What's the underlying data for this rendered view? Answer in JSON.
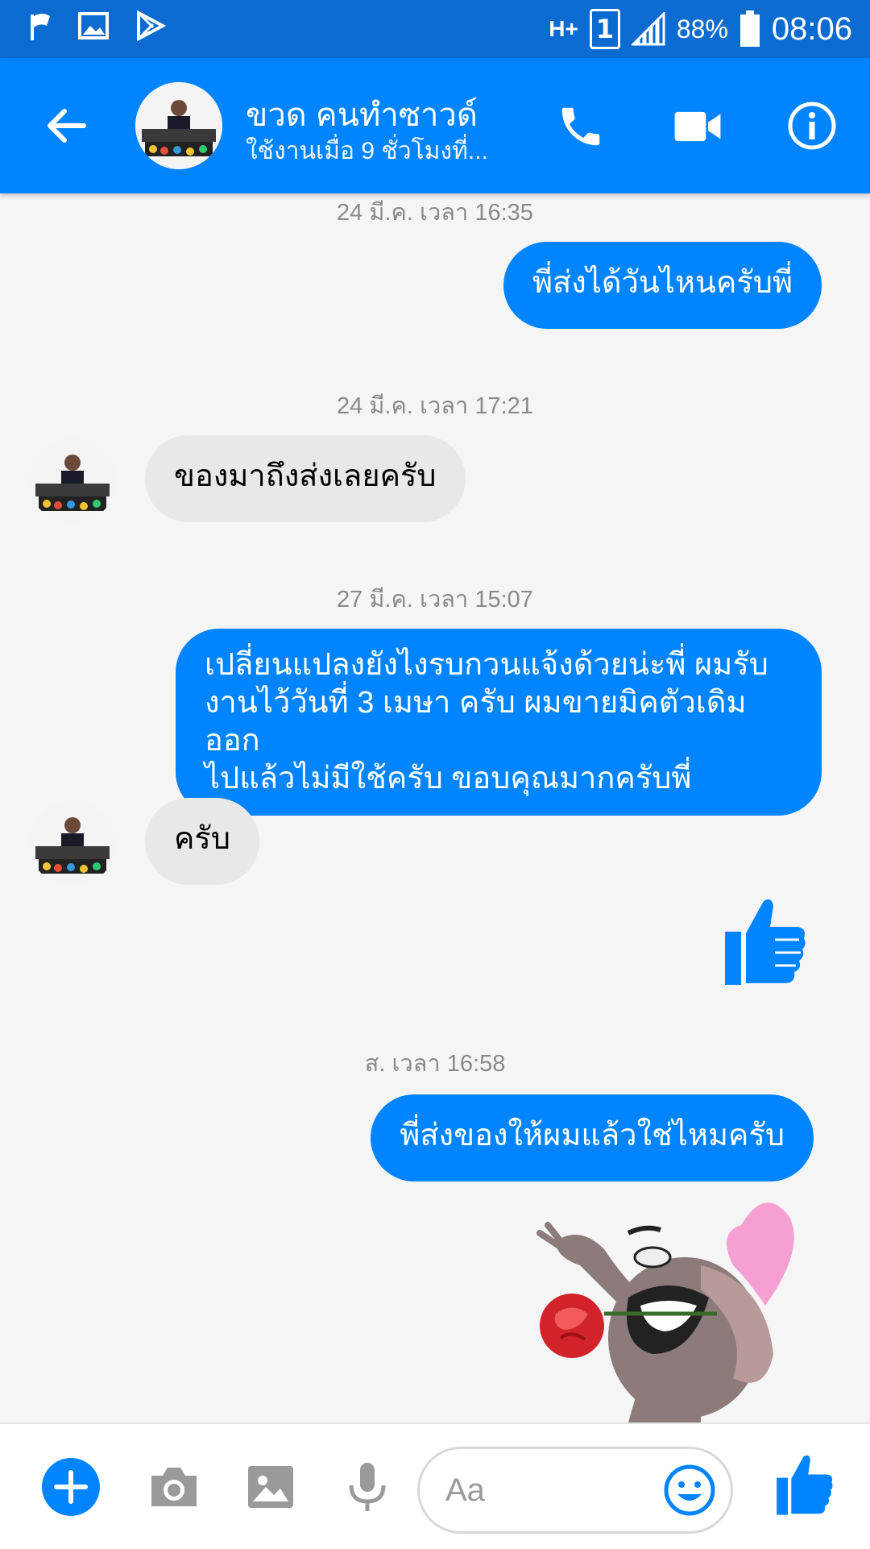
{
  "status_bar": {
    "network": "H+",
    "sim": "1",
    "battery": "88%",
    "time": "08:06"
  },
  "header": {
    "contact_name": "ขวด คนทำซาวด์",
    "contact_status": "ใช้งานเมื่อ 9 ชั่วโมงที่...",
    "icons": [
      "back-arrow-icon",
      "phone-icon",
      "video-camera-icon",
      "info-icon"
    ]
  },
  "messages": {
    "ts1": "24 มี.ค. เวลา 16:35",
    "m1": "พี่ส่งได้วันไหนครับพี่",
    "ts2": "24 มี.ค. เวลา 17:21",
    "m2": "ของมาถึงส่งเลยครับ",
    "ts3": "27 มี.ค. เวลา 15:07",
    "m3_line1": "เปลี่ยนแปลงยังไงรบกวนแจ้งด้วยน่ะพี่ ผมรับ",
    "m3_line2": "งานไว้วันที่ 3 เมษา ครับ ผมขายมิคตัวเดิมออก",
    "m3_line3": "ไปแล้วไม่มีใช้ครับ ขอบคุณมากครับพี่",
    "m4": "ครับ",
    "ts4": "ส. เวลา 16:58",
    "m5": "พี่ส่งของให้ผมแล้วใช่ไหมครับ"
  },
  "composer": {
    "placeholder": "Aa",
    "icons": [
      "plus-icon",
      "camera-icon",
      "image-icon",
      "microphone-icon",
      "emoji-icon",
      "like-icon"
    ]
  },
  "colors": {
    "messenger_blue": "#0084ff",
    "status_bar": "#0b6bd0",
    "incoming_bubble": "#e8e8e8",
    "timestamp": "#8a8a8a"
  }
}
